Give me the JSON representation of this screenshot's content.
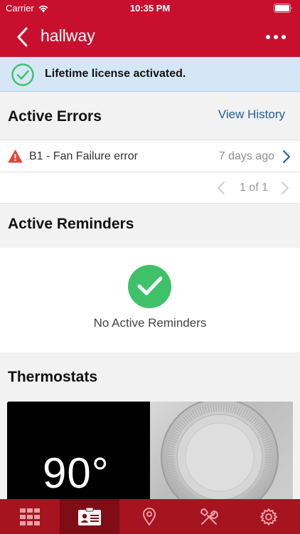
{
  "status_bar": {
    "carrier": "Carrier",
    "time": "10:35 PM"
  },
  "nav": {
    "title": "hallway",
    "back_icon": "chevron-left-icon",
    "more_icon": "more-horizontal-icon"
  },
  "banner": {
    "text": "Lifetime license activated.",
    "icon": "check-circle-icon"
  },
  "errors": {
    "title": "Active Errors",
    "view_history": "View History",
    "items": [
      {
        "label": "B1 - Fan Failure error",
        "time": "7 days ago",
        "icon": "warning-icon"
      }
    ],
    "pager": "1 of 1"
  },
  "reminders": {
    "title": "Active Reminders",
    "empty_text": "No Active Reminders"
  },
  "thermostats": {
    "title": "Thermostats",
    "items": [
      {
        "temperature": "90°"
      }
    ]
  },
  "tabs": [
    {
      "icon": "grid-icon",
      "active": false
    },
    {
      "icon": "contact-card-icon",
      "active": true
    },
    {
      "icon": "location-pin-icon",
      "active": false
    },
    {
      "icon": "tools-icon",
      "active": false
    },
    {
      "icon": "settings-gear-icon",
      "active": false
    }
  ],
  "colors": {
    "brand_red": "#c8102e",
    "tab_bar": "#a5141f",
    "tab_active": "#7e0d16",
    "banner_bg": "#d5e7f6",
    "success_green": "#3fc16a",
    "link_blue": "#1f5fa0",
    "warning_red": "#e0453a"
  }
}
